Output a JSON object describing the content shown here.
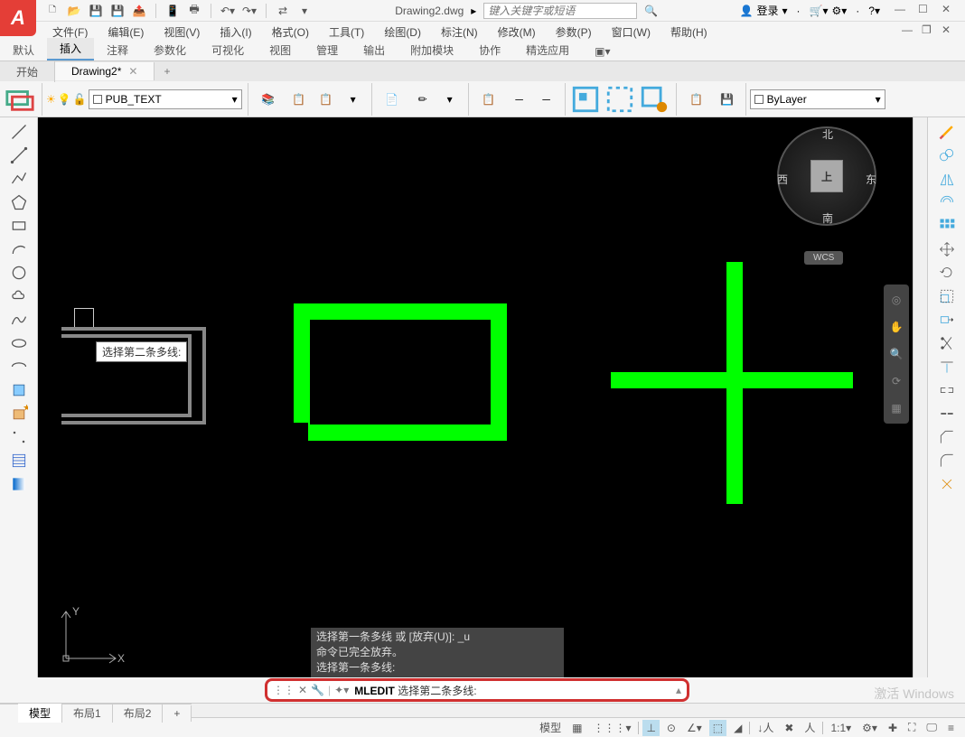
{
  "title": {
    "doc": "Drawing2.dwg",
    "search_placeholder": "键入关键字或短语",
    "login": "登录"
  },
  "menubar": [
    "文件(F)",
    "编辑(E)",
    "视图(V)",
    "插入(I)",
    "格式(O)",
    "工具(T)",
    "绘图(D)",
    "标注(N)",
    "修改(M)",
    "参数(P)",
    "窗口(W)",
    "帮助(H)"
  ],
  "ribbon_tabs": [
    "默认",
    "插入",
    "注释",
    "参数化",
    "可视化",
    "视图",
    "管理",
    "输出",
    "附加模块",
    "协作",
    "精选应用"
  ],
  "ribbon_active": 1,
  "doc_tabs": {
    "tabs": [
      "开始",
      "Drawing2*"
    ],
    "active": 1
  },
  "layer_name": "PUB_TEXT",
  "bylayer_combo": "ByLayer",
  "viewcube": {
    "face": "上",
    "n": "北",
    "s": "南",
    "e": "东",
    "w": "西",
    "wcs": "WCS"
  },
  "tooltip": "选择第二条多线:",
  "history": [
    "选择第一条多线 或 [放弃(U)]:  _u",
    "命令已完全放弃。",
    "选择第一条多线:"
  ],
  "command": {
    "name": "MLEDIT",
    "prompt": "选择第二条多线:"
  },
  "bottom_tabs": [
    "模型",
    "布局1",
    "布局2"
  ],
  "status": {
    "model": "模型",
    "scale": "1:1"
  },
  "watermark": "激活 Windows"
}
